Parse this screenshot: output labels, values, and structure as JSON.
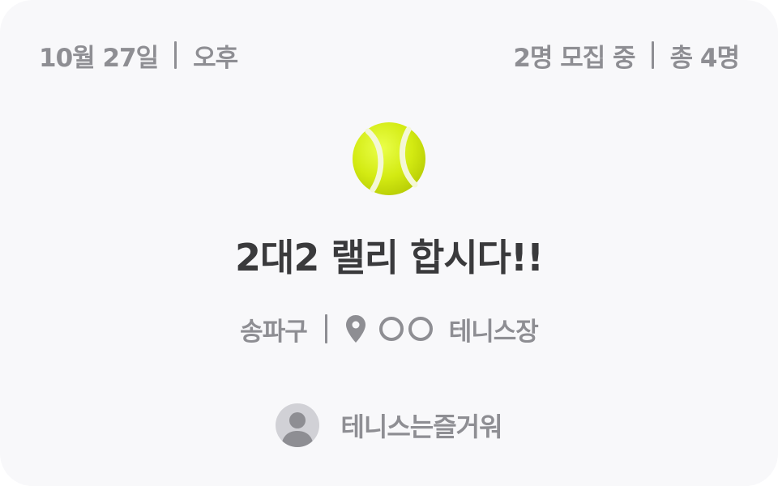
{
  "header": {
    "date": "10월 27일",
    "time_of_day": "오후",
    "recruit_status": "2명 모집 중",
    "total_count": "총 4명"
  },
  "match": {
    "sport_icon": "tennis-ball-icon",
    "title": "2대2 랠리 합시다!!"
  },
  "location": {
    "district": "송파구",
    "pin_icon": "location-pin-icon",
    "venue": "테니스장"
  },
  "author": {
    "avatar_icon": "default-avatar-icon",
    "name": "테니스는즐거워"
  },
  "colors": {
    "card_background": "#f8f8fa",
    "muted_text": "#8e8e93",
    "title_text": "#3a3a3c",
    "ball": "#d7ef1f"
  }
}
